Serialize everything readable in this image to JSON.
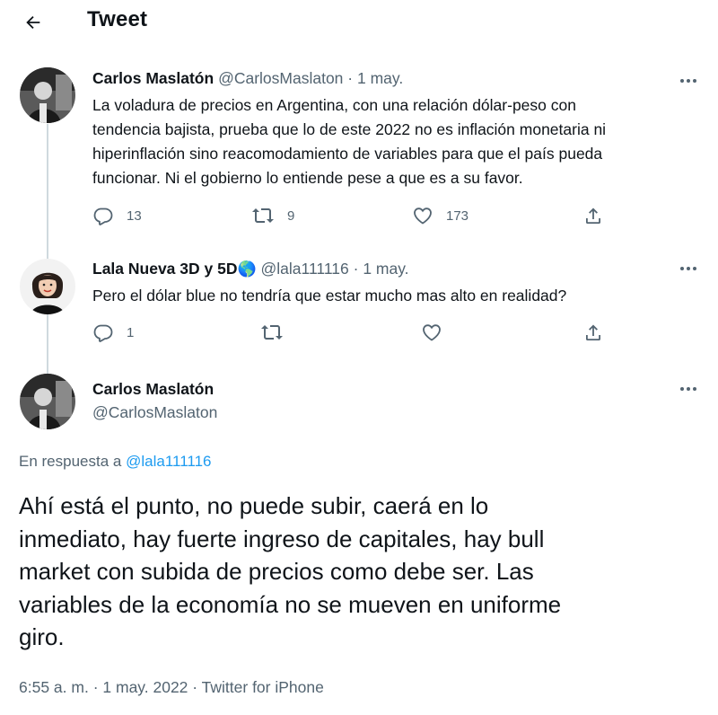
{
  "header": {
    "title": "Tweet"
  },
  "tweets": [
    {
      "name": "Carlos Maslatón",
      "handle": "@CarlosMaslaton",
      "separator": "·",
      "date": "1 may.",
      "text_lines": [
        "La voladura de precios en Argentina, con una relación dólar-peso con",
        "tendencia bajista, prueba que lo de este 2022 no es inflación monetaria ni",
        "hiperinflación sino reacomodamiento de variables para que el país pueda",
        "funcionar. Ni el gobierno lo entiende pese a que es a su favor."
      ],
      "replies": "13",
      "retweets": "9",
      "likes": "173"
    },
    {
      "name": "Lala Nueva 3D y 5D",
      "name_emoji": "🌎",
      "handle": "@lala111116",
      "separator": "·",
      "date": "1 may.",
      "text_lines": [
        "Pero el dólar blue no tendría que estar mucho mas alto en realidad?"
      ],
      "replies": "1",
      "retweets": "",
      "likes": ""
    }
  ],
  "main_tweet": {
    "name": "Carlos Maslatón",
    "handle": "@CarlosMaslaton",
    "reply_prefix": "En respuesta a",
    "reply_mention": "@lala111116",
    "text_lines": [
      "Ahí está el punto, no puede subir, caerá en lo",
      "inmediato, hay fuerte ingreso de capitales, hay bull",
      "market con subida de precios como debe ser. Las",
      "variables de la economía no se mueven en uniforme",
      "giro."
    ],
    "time": "6:55 a. m.",
    "separator": "·",
    "date": "1 may. 2022",
    "source": "Twitter for iPhone"
  },
  "colors": {
    "text": "#0f1419",
    "secondary": "#536471",
    "accent": "#1d9bf0",
    "thread_line": "#cfd9de"
  }
}
